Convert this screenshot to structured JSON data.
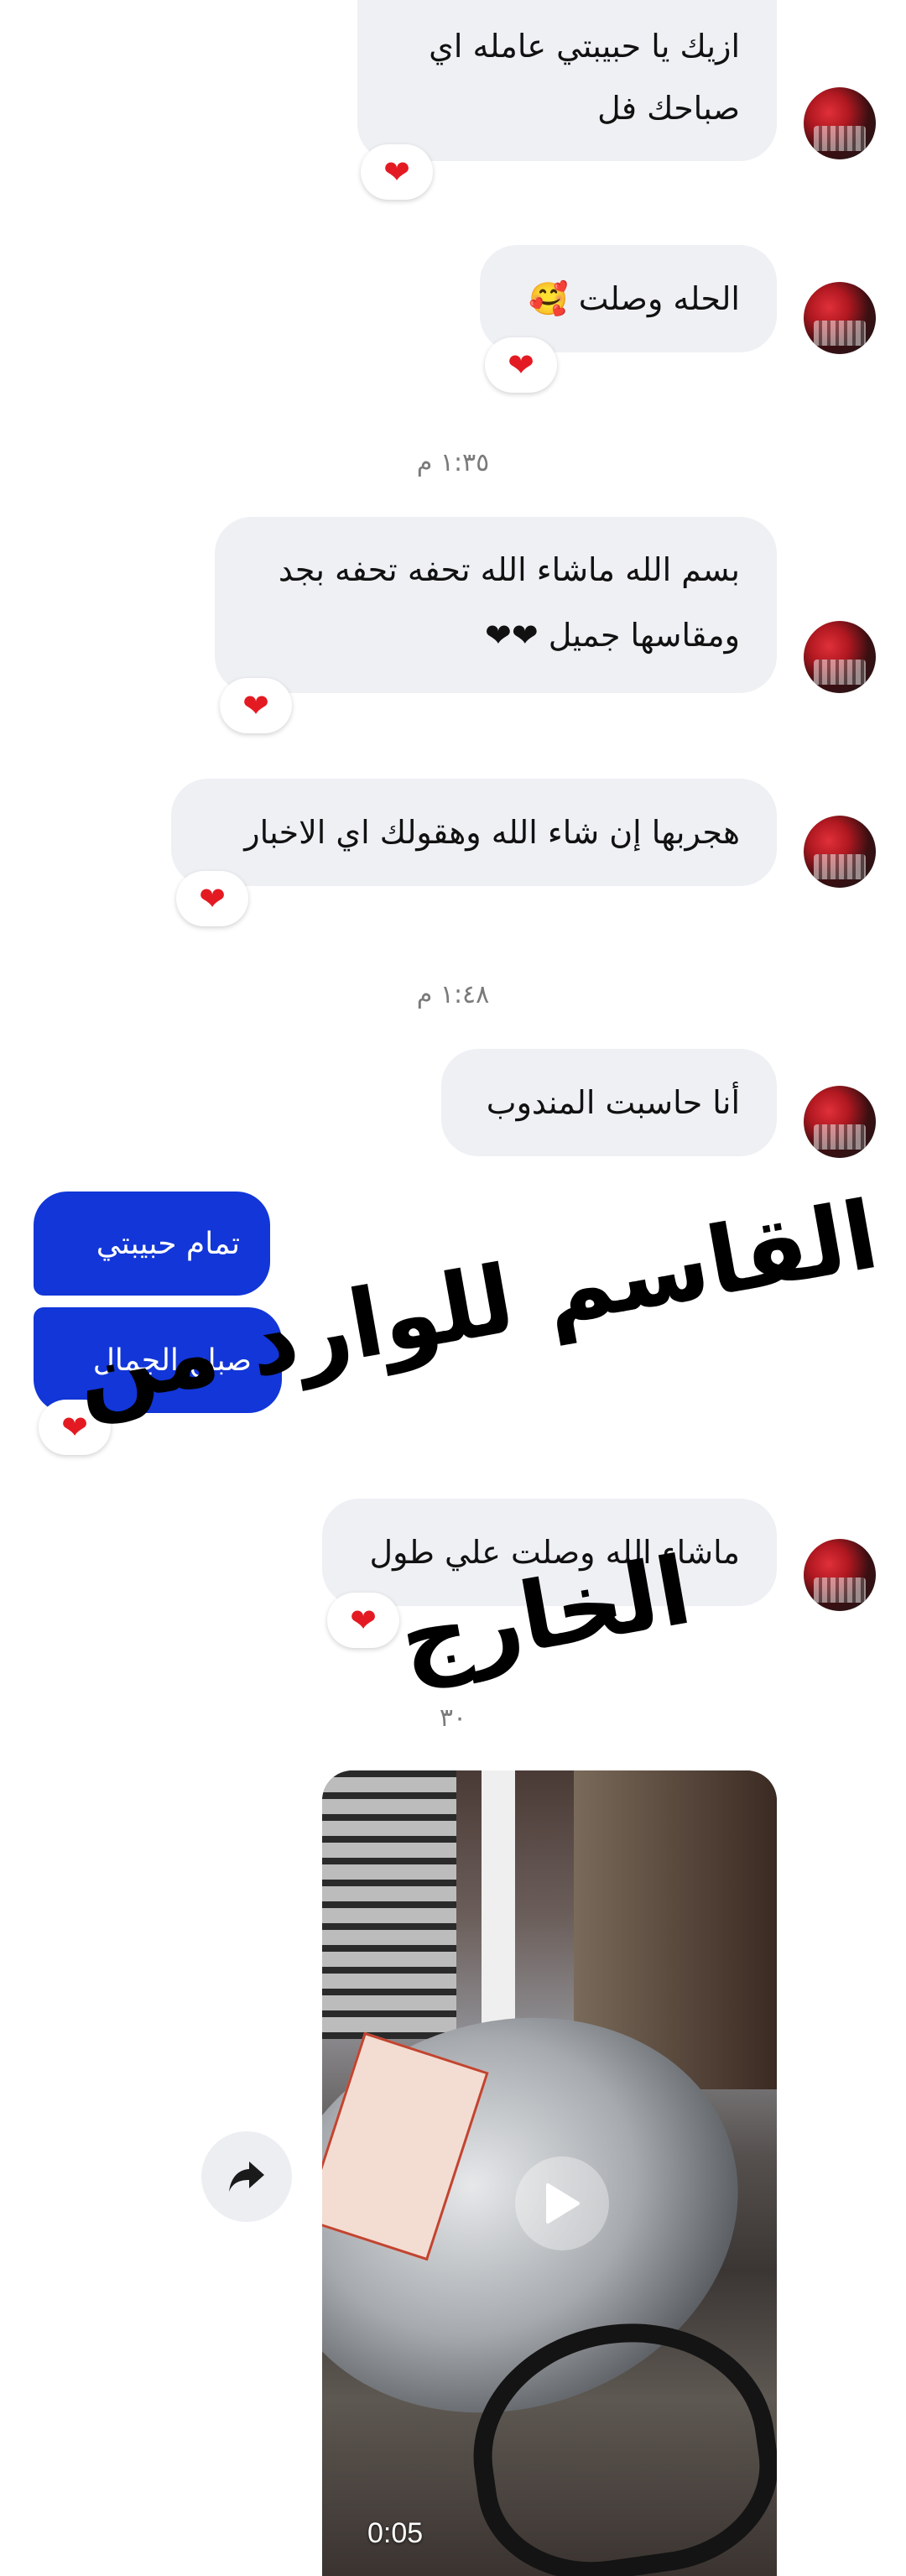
{
  "messages": {
    "m1_line1": "ازيك يا حبيبتي عامله اي",
    "m1_line2": "صباحك فل",
    "m2": "الحله وصلت 🥰",
    "m3_line1": "بسم الله ماشاء الله تحفه تحفه بجد",
    "m3_line2": "ومقاسها جميل ❤❤",
    "m4": "هجربها إن شاء الله وهقولك  اي الاخبار",
    "m5": "أنا حاسبت المندوب",
    "m6": "ماشاء الله وصلت علي طول"
  },
  "outgoing": {
    "o1": "تمام حبيبتي",
    "o2": "صباح الجمال"
  },
  "timestamps": {
    "t1": "١:٣٥ م",
    "t2": "١:٤٨ م",
    "t3": "٣٠"
  },
  "reaction": "❤",
  "video": {
    "duration": "0:05"
  },
  "watermark": {
    "line1": "القاسم للوارد من",
    "line2": "الخارج"
  },
  "colors": {
    "incoming_bubble": "#eef0f4",
    "outgoing_bubble": "#1236d8",
    "reaction_heart": "#e41a22"
  },
  "icons": [
    "avatar",
    "heart-reaction-icon",
    "share-icon",
    "play-icon"
  ]
}
